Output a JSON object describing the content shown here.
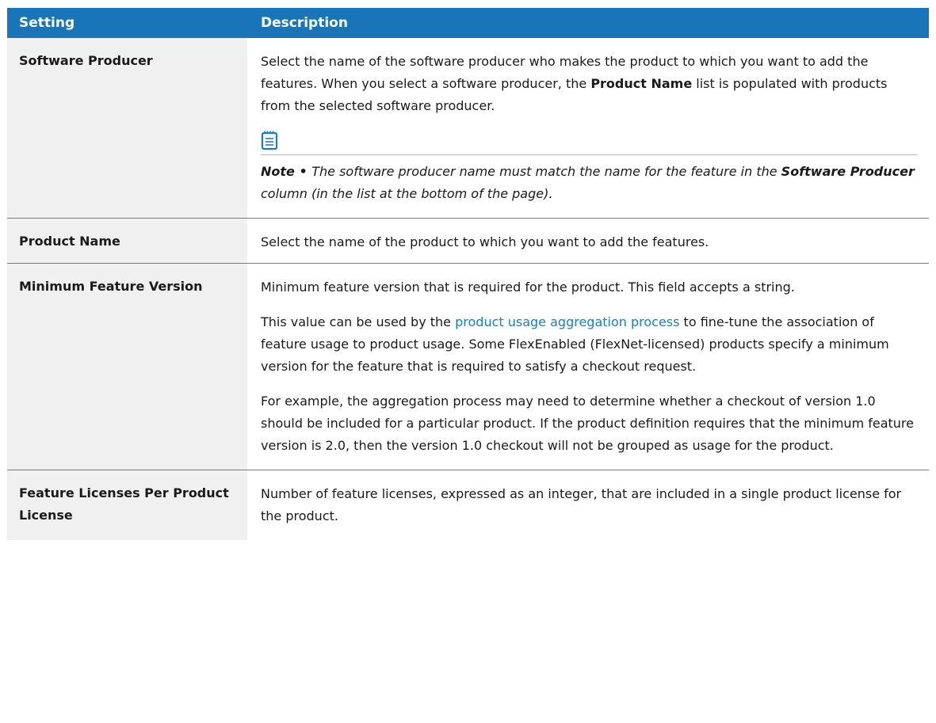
{
  "header": {
    "setting": "Setting",
    "description": "Description"
  },
  "rows": [
    {
      "setting": "Software Producer",
      "p1_a": "Select the name of the software producer who makes the product to which you want to add the features. When you select a software producer, the ",
      "p1_b": "Product Name",
      "p1_c": " list is populated with products from the selected software producer.",
      "note_icon": "notepad-icon",
      "note_label": "Note • ",
      "note_a": "The software producer name must match the name for the feature in the ",
      "note_b": "Software Producer",
      "note_c": " column (in the list at the bottom of the page)."
    },
    {
      "setting": "Product Name",
      "p1": "Select the name of the product to which you want to add the features."
    },
    {
      "setting": "Minimum Feature Version",
      "p1": "Minimum feature version that is required for the product. This field accepts a string.",
      "p2_a": "This value can be used by the ",
      "p2_link": "product usage aggregation process",
      "p2_b": " to fine-tune the association of feature usage to product usage. Some FlexEnabled (FlexNet-licensed) products specify a minimum version for the feature that is required to satisfy a checkout request.",
      "p3": "For example, the aggregation process may need to determine whether a checkout of version 1.0 should be included for a particular product. If the product definition requires that the minimum feature version is 2.0, then the version 1.0 checkout will not be grouped as usage for the product."
    },
    {
      "setting": "Feature Licenses Per Product License",
      "p1": "Number of feature licenses, expressed as an integer, that are included in a single product license for the product."
    }
  ],
  "colors": {
    "header_bg": "#1a75b8",
    "setting_bg": "#f0f0f0",
    "link": "#1e7bc2",
    "icon": "#1e7bc2"
  }
}
